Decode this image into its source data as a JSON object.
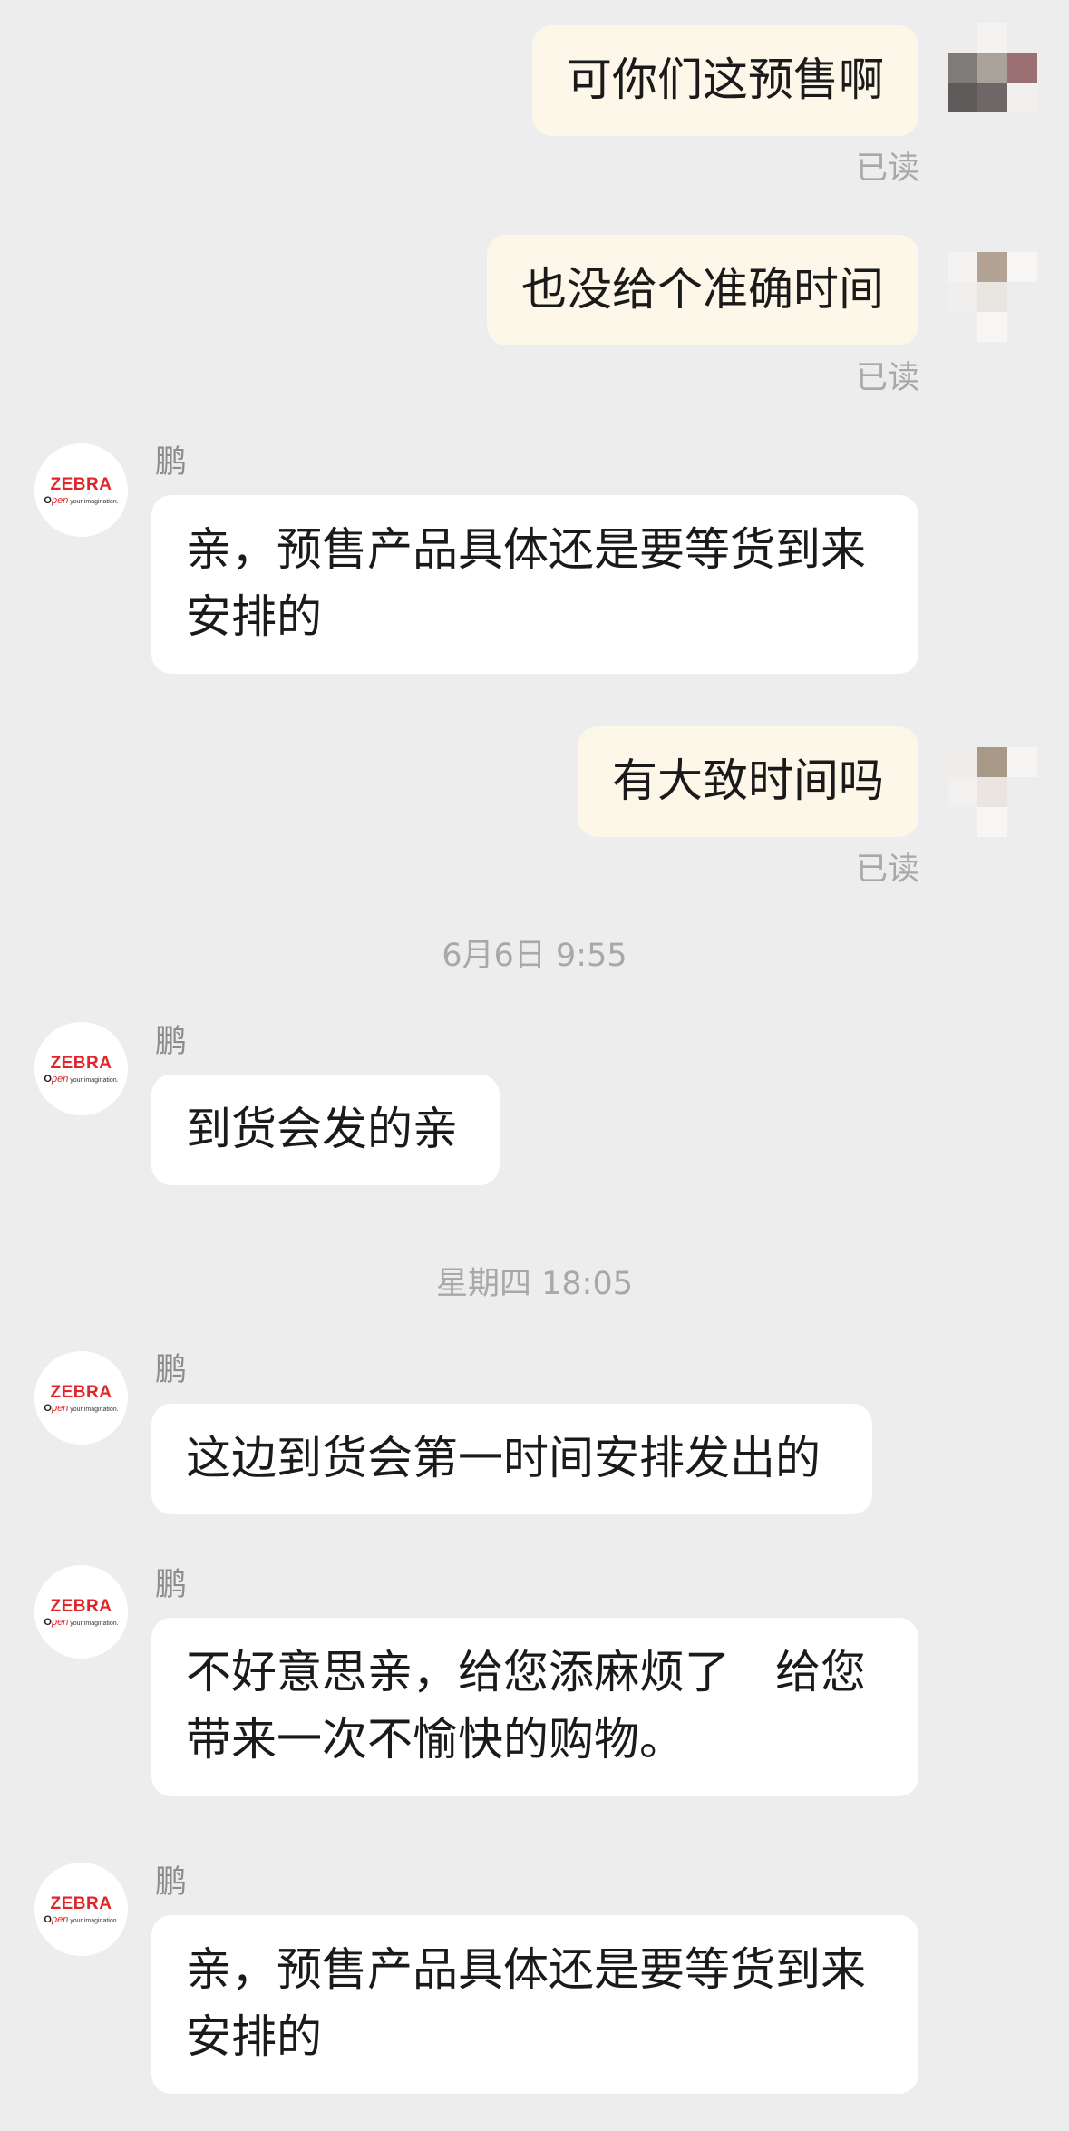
{
  "messages": {
    "m1": {
      "text": "可你们这预售啊",
      "status": "已读"
    },
    "m2": {
      "text": "也没给个准确时间",
      "status": "已读"
    },
    "m3": {
      "sender": "鹏",
      "line1": "亲，预售产品具体还是要等货到来",
      "line2": "安排的"
    },
    "m4": {
      "text": "有大致时间吗",
      "status": "已读"
    },
    "t1": "6月6日 9:55",
    "m5": {
      "sender": "鹏",
      "text": "到货会发的亲"
    },
    "t2": "星期四 18:05",
    "m6": {
      "sender": "鹏",
      "text": "这边到货会第一时间安排发出的"
    },
    "m7": {
      "sender": "鹏",
      "line1": "不好意思亲，给您添麻烦了　给您",
      "line2": "带来一次不愉快的购物。"
    },
    "m8": {
      "sender": "鹏",
      "line1": "亲，预售产品具体还是要等货到来",
      "line2": "安排的"
    }
  },
  "shop_logo": {
    "brand": "ZEBRA",
    "tag_o": "O",
    "tag_pen": "pen",
    "tag_rest": " your imagination.",
    "brand_color": "#e0262b"
  },
  "colors": {
    "background": "#ededed",
    "outgoing_bubble": "#fdf7e9",
    "incoming_bubble": "#ffffff",
    "meta_text": "#a8a8a8"
  },
  "icons": {
    "user_avatar": "pixelated-avatar",
    "shop_avatar": "zebra-logo-avatar"
  }
}
